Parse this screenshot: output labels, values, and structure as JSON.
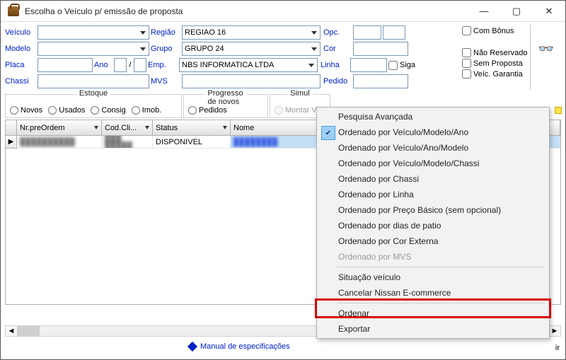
{
  "window": {
    "title": "Escolha o Veículo p/ emissão de proposta"
  },
  "labels": {
    "veiculo": "Veículo",
    "modelo": "Modelo",
    "placa": "Placa",
    "ano": "Ano",
    "chassi": "Chassi",
    "regiao": "Região",
    "grupo": "Grupo",
    "emp": "Emp.",
    "mvs": "MVS",
    "opc": "Opc.",
    "cor": "Cor",
    "linha": "Linha",
    "pedido": "Pedido",
    "siga": "Siga"
  },
  "fields": {
    "veiculo": "",
    "modelo": "",
    "placa": "",
    "ano_a": "",
    "ano_b": "",
    "chassi": "",
    "regiao": "REGIAO 16",
    "grupo": "GRUPO 24",
    "emp": "NBS INFORMATICA LTDA",
    "mvs": "",
    "opc_a": "",
    "opc_b": "",
    "cor": "",
    "linha": "",
    "pedido": ""
  },
  "checkboxes": {
    "com_bonus": "Com Bônus",
    "nao_reservado": "Não Reservado",
    "sem_proposta": "Sem Proposta",
    "veic_garantia": "Veíc. Garantia"
  },
  "groups": {
    "estoque": {
      "legend": "Estoque",
      "novos": "Novos",
      "usados": "Usados",
      "consig": "Consig",
      "imob": "Imob."
    },
    "progresso": {
      "legend": "Progresso de novos",
      "pedidos": "Pedidos"
    },
    "simul": {
      "legend": "Simul",
      "montar": "Montar V"
    }
  },
  "grid": {
    "headers": {
      "preordem": "Nr.preOrdem",
      "codcli": "Cod.Cli...",
      "status": "Status",
      "nome": "Nome"
    },
    "rows": [
      {
        "preordem": "██████████",
        "codcli": "███ █████",
        "status": "DISPONIVEL",
        "nome": "████████"
      }
    ]
  },
  "menu": {
    "pesquisa": "Pesquisa Avançada",
    "veic_modelo_ano": "Ordenado por Veículo/Modelo/Ano",
    "veic_ano_modelo": "Ordenado por Veículo/Ano/Modelo",
    "veic_modelo_chassi": "Ordenado por Veículo/Modelo/Chassi",
    "chassi": "Ordenado por Chassi",
    "linha": "Ordenado por Linha",
    "preco": "Ordenado por Preço Básico (sem opcional)",
    "dias": "Ordenado por dias de patio",
    "cor": "Ordenado por Cor Externa",
    "mvs": "Ordenado por MVS",
    "situacao": "Situação veículo",
    "cancelar": "Cancelar Nissan E-commerce",
    "ordenar": "Ordenar",
    "exportar": "Exportar"
  },
  "footer": {
    "manual": "Manual de especificações",
    "ir": "ir"
  }
}
